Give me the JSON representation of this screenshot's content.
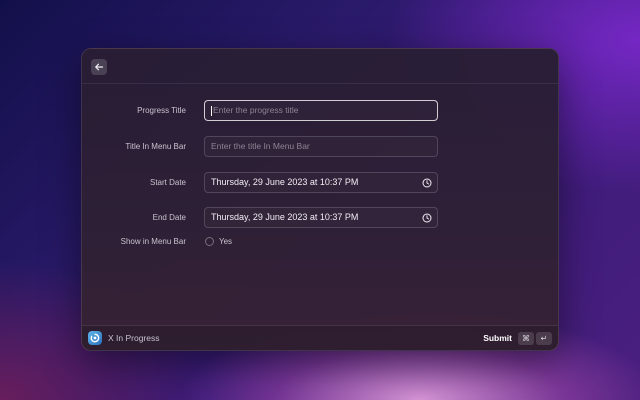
{
  "window": {
    "back_icon": "arrow-left-icon"
  },
  "form": {
    "progress_title": {
      "label": "Progress Title",
      "placeholder": "Enter the progress title",
      "value": ""
    },
    "menu_bar_title": {
      "label": "Title In Menu Bar",
      "placeholder": "Enter the title In Menu Bar",
      "value": ""
    },
    "start_date": {
      "label": "Start Date",
      "value": "Thursday, 29 June 2023 at 10:37 PM",
      "icon": "clock-icon"
    },
    "end_date": {
      "label": "End Date",
      "value": "Thursday, 29 June 2023 at 10:37 PM",
      "icon": "clock-icon"
    },
    "show_in_menu_bar": {
      "label": "Show in Menu Bar",
      "option_label": "Yes",
      "checked": false
    }
  },
  "footer": {
    "extension_name": "X In Progress",
    "extension_icon": "progress-app-icon",
    "submit_label": "Submit",
    "shortcut_cmd": "⌘",
    "shortcut_return": "↵"
  }
}
